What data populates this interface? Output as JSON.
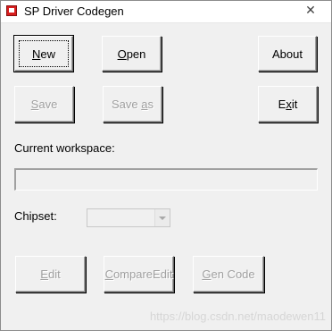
{
  "window": {
    "title": "SP Driver Codegen",
    "close_glyph": "✕"
  },
  "buttons": {
    "new": {
      "pre": "",
      "ul": "N",
      "post": "ew"
    },
    "open": {
      "pre": "",
      "ul": "O",
      "post": "pen"
    },
    "about": {
      "label": "About"
    },
    "save": {
      "pre": "",
      "ul": "S",
      "post": "ave"
    },
    "save_as": {
      "pre": "Save ",
      "ul": "a",
      "post": "s"
    },
    "exit": {
      "pre": "E",
      "ul": "x",
      "post": "it"
    },
    "edit": {
      "pre": "",
      "ul": "E",
      "post": "dit"
    },
    "compare_edit": {
      "pre": "",
      "ul": "C",
      "post": "ompareEdit"
    },
    "gen_code": {
      "pre": "",
      "ul": "G",
      "post": "en Code"
    }
  },
  "workspace": {
    "label": "Current workspace:",
    "value": ""
  },
  "chipset": {
    "label": "Chipset:",
    "value": ""
  },
  "watermark": "https://blog.csdn.net/maodewen11"
}
